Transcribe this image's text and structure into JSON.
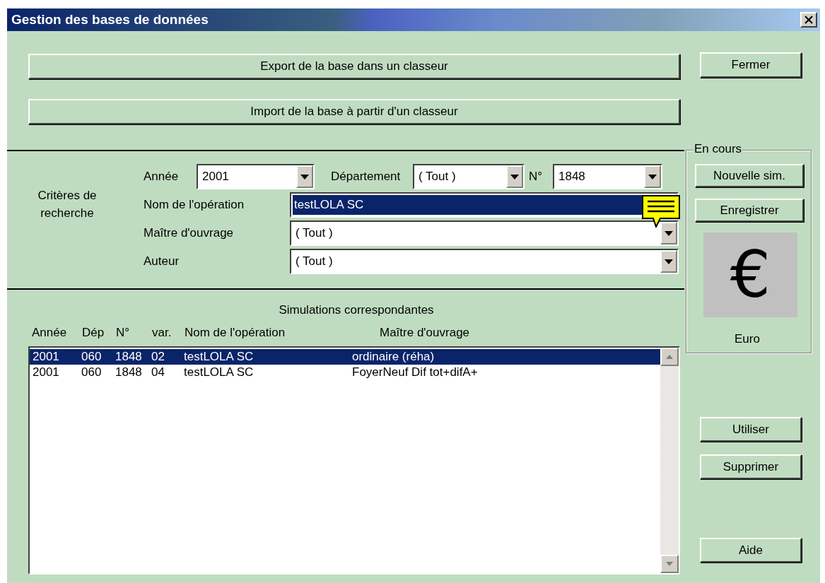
{
  "window": {
    "title": "Gestion des bases de données"
  },
  "buttons": [
    {
      "label": "Export de la base dans un classeur"
    },
    {
      "label": "Import de la base à partir d'un classeur"
    }
  ],
  "close_button": {
    "label": "Fermer"
  },
  "criteria": {
    "heading": "Critères de recherche",
    "top_row": [
      {
        "label": "Année",
        "value": "2001"
      },
      {
        "label": "Département",
        "value": "( Tout )"
      },
      {
        "label": "N°",
        "value": "1848"
      }
    ],
    "rows": [
      {
        "label": "Nom de l'opération",
        "value": "testLOLA SC",
        "selected": true,
        "has_note": true
      },
      {
        "label": "Maître d'ouvrage",
        "value": "( Tout )",
        "selected": false,
        "has_note": false
      },
      {
        "label": "Auteur",
        "value": "( Tout )",
        "selected": false,
        "has_note": false
      }
    ]
  },
  "current": {
    "title": "En cours",
    "buttons": [
      "Nouvelle sim.",
      "Enregistrer"
    ],
    "symbol": "€",
    "currency": "Euro"
  },
  "simulations": {
    "title": "Simulations correspondantes",
    "columns": [
      "Année",
      "Dép",
      "N°",
      "var.",
      "Nom de l'opération",
      "Maître d'ouvrage"
    ],
    "rows": [
      {
        "cells": [
          "2001",
          "060",
          "1848",
          "02",
          "testLOLA SC",
          "ordinaire (réha)"
        ],
        "selected": true
      },
      {
        "cells": [
          "2001",
          "060",
          "1848",
          "04",
          "testLOLA SC",
          "FoyerNeuf Dif tot+difA+"
        ],
        "selected": false
      }
    ]
  },
  "actions": [
    "Utiliser",
    "Supprimer",
    "Aide"
  ]
}
